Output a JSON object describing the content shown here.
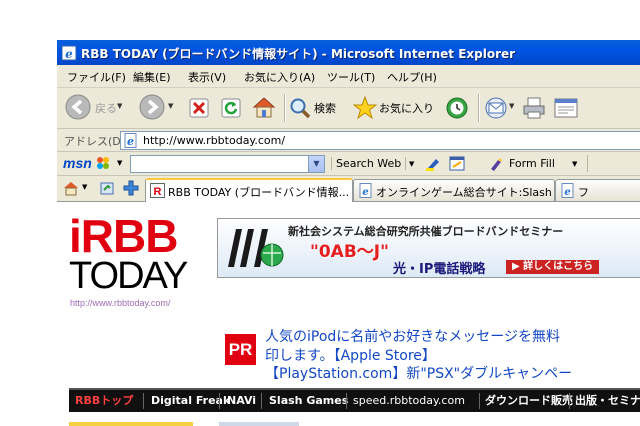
{
  "window": {
    "title": "RBB TODAY (ブロードバンド情報サイト) - Microsoft Internet Explorer"
  },
  "menu": [
    "ファイル(F)",
    "編集(E)",
    "表示(V)",
    "お気に入り(A)",
    "ツール(T)",
    "ヘルプ(H)"
  ],
  "toolbar": {
    "back_label": "戻る",
    "search_label": "検索",
    "favorites_label": "お気に入り"
  },
  "address": {
    "label": "アドレス(D)",
    "url": "http://www.rbbtoday.com/"
  },
  "msn": {
    "logo": "msn",
    "search_value": "",
    "search_web_label": "Search Web",
    "form_fill_label": "Form Fill"
  },
  "tabs": [
    {
      "label": "RBB TODAY (ブロードバンド情報...",
      "active": true
    },
    {
      "label": "オンラインゲーム総合サイト:Slash ...",
      "active": false
    },
    {
      "label": "フ",
      "active": false
    }
  ],
  "page": {
    "logo_top": "RBB",
    "logo_top_i": "i",
    "logo_bottom": "TODAY",
    "logo_url": "http://www.rbbtoday.com/",
    "banner": {
      "line1": "新社会システム総合研究所共催ブロードバンドセミナー",
      "line2": "\"0AB〜J\"",
      "line3": "光・IP電話戦略",
      "button": "▶ 詳しくはこちら"
    },
    "pr_badge": "PR",
    "pr_links": [
      "人気のiPodに名前やお好きなメッセージを無料",
      "印します。【Apple Store】",
      "【PlayStation.com】新\"PSX\"ダブルキャンペー"
    ],
    "nav": [
      "RBBトップ",
      "Digital Freak",
      "NAVi",
      "Slash Games",
      "speed.rbbtoday.com",
      "ダウンロード販売",
      "出版・セミナー"
    ]
  },
  "colors": {
    "titlebar": "#0054e3",
    "logo_red": "#e00010",
    "link_blue": "#1447c6",
    "nav_bg": "#101010"
  }
}
